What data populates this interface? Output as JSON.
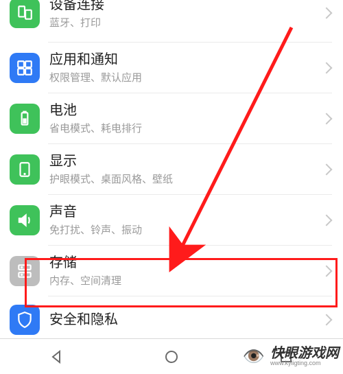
{
  "settings": {
    "items": [
      {
        "id": "device-connection",
        "title": "设备连接",
        "subtitle": "蓝牙、打印",
        "icon": "devices",
        "color": "green"
      },
      {
        "id": "apps-notifications",
        "title": "应用和通知",
        "subtitle": "权限管理、默认应用",
        "icon": "apps",
        "color": "blue"
      },
      {
        "id": "battery",
        "title": "电池",
        "subtitle": "省电模式、耗电排行",
        "icon": "battery",
        "color": "green"
      },
      {
        "id": "display",
        "title": "显示",
        "subtitle": "护眼模式、桌面风格、壁纸",
        "icon": "display",
        "color": "green"
      },
      {
        "id": "sound",
        "title": "声音",
        "subtitle": "免打扰、铃声、振动",
        "icon": "sound",
        "color": "green"
      },
      {
        "id": "storage",
        "title": "存储",
        "subtitle": "内存、空间清理",
        "icon": "storage",
        "color": "gray"
      },
      {
        "id": "security-privacy",
        "title": "安全和隐私",
        "subtitle": "",
        "icon": "shield",
        "color": "blue"
      }
    ]
  },
  "annotation": {
    "highlighted_item": "storage"
  },
  "watermark": {
    "text": "快眼游戏网",
    "url": "www.kyligting.com"
  }
}
